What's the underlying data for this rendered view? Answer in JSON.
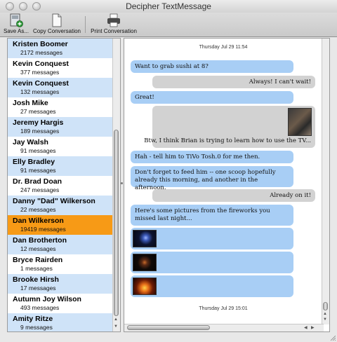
{
  "window": {
    "title": "Decipher TextMessage"
  },
  "toolbar": {
    "save_label": "Save As...",
    "copy_label": "Copy Conversation",
    "print_label": "Print Conversation"
  },
  "contacts": [
    {
      "name": "Kristen Boomer",
      "count": "2172 messages"
    },
    {
      "name": "Kevin Conquest",
      "count": "377 messages"
    },
    {
      "name": "Kevin Conquest",
      "count": "132 messages"
    },
    {
      "name": "Josh Mike",
      "count": "27 messages"
    },
    {
      "name": "Jeremy Hargis",
      "count": "189 messages"
    },
    {
      "name": "Jay Walsh",
      "count": "91 messages"
    },
    {
      "name": "Elly Bradley",
      "count": "91 messages"
    },
    {
      "name": "Dr. Brad Doan",
      "count": "247 messages"
    },
    {
      "name": "Danny \"Dad\" Wilkerson",
      "count": "22 messages"
    },
    {
      "name": "Dan Wilkerson",
      "count": "19419 messages"
    },
    {
      "name": "Dan Brotherton",
      "count": "12 messages"
    },
    {
      "name": "Bryce Rairden",
      "count": "1 messages"
    },
    {
      "name": "Brooke Hirsh",
      "count": "17 messages"
    },
    {
      "name": "Autumn Joy Wilson",
      "count": "493 messages"
    },
    {
      "name": "Amity Ritze",
      "count": "9 messages"
    }
  ],
  "selected_contact": "Dan Wilkerson",
  "conversation": {
    "stamp1": "Thursday Jul 29 11:54",
    "stamp2": "Thursday Jul 29 15:01",
    "messages": [
      {
        "dir": "in",
        "text": "Want to grab sushi at 8?"
      },
      {
        "dir": "out",
        "text": "Always! I can't wait!"
      },
      {
        "dir": "in",
        "text": "Great!"
      },
      {
        "dir": "out",
        "text": "Btw, I think Brian is trying to learn how to use the TV..."
      },
      {
        "dir": "in",
        "text": "Hah - tell him to TiVo Tosh.0 for me then."
      },
      {
        "dir": "in",
        "text": "Don't forget to feed him -- one scoop hopefully already this morning, and another in the afternoon."
      },
      {
        "dir": "out",
        "text": "Already on it!"
      },
      {
        "dir": "in",
        "text": "Here's some pictures from the fireworks you missed last night..."
      }
    ]
  },
  "colors": {
    "selected": "#f79a16",
    "incoming": "#a8cef5",
    "outgoing": "#d2d2d2",
    "row_alt": "#cfe3f8"
  }
}
